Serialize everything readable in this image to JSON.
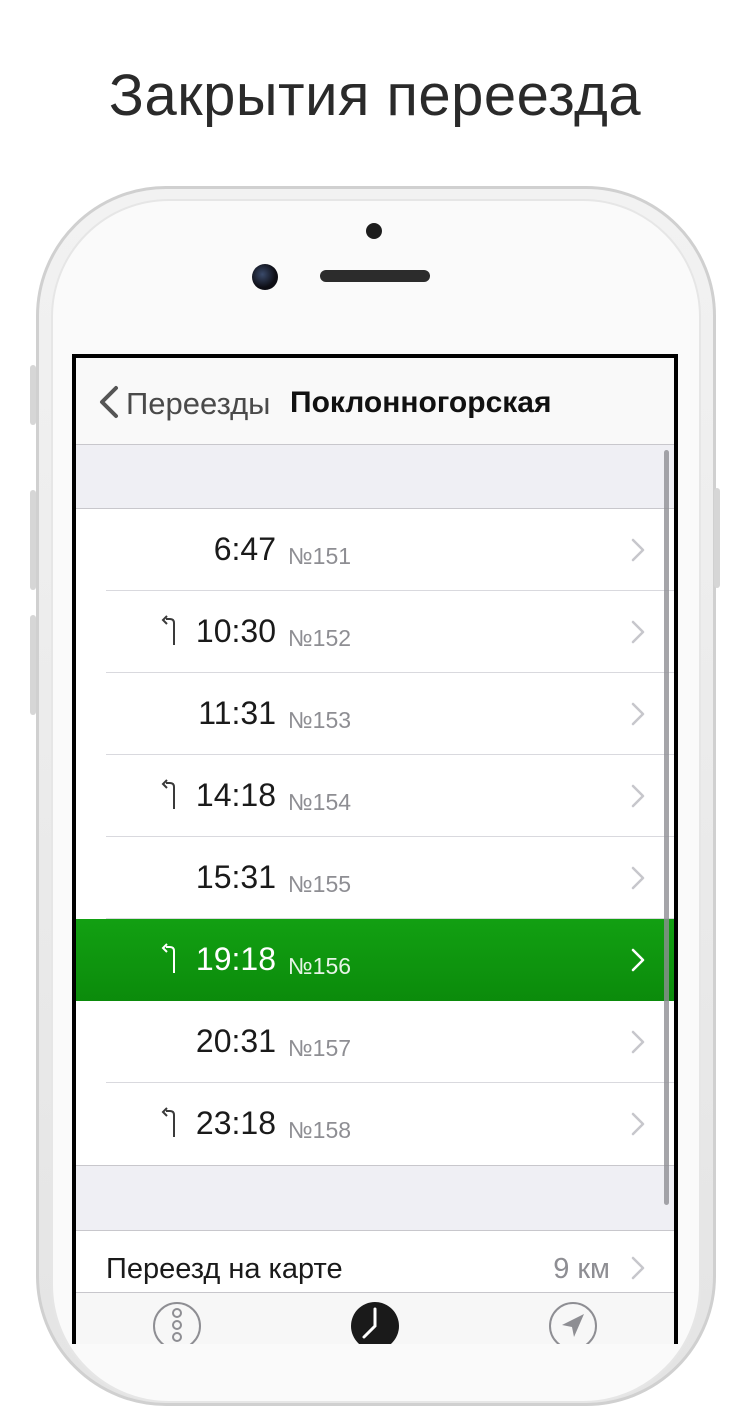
{
  "headline": "Закрытия переезда",
  "navbar": {
    "back_label": "Переезды",
    "title": "Поклонногорская"
  },
  "closures": [
    {
      "time": "6:47",
      "number": "№151",
      "turn_icon": false,
      "active": false
    },
    {
      "time": "10:30",
      "number": "№152",
      "turn_icon": true,
      "active": false
    },
    {
      "time": "11:31",
      "number": "№153",
      "turn_icon": false,
      "active": false
    },
    {
      "time": "14:18",
      "number": "№154",
      "turn_icon": true,
      "active": false
    },
    {
      "time": "15:31",
      "number": "№155",
      "turn_icon": false,
      "active": false
    },
    {
      "time": "19:18",
      "number": "№156",
      "turn_icon": true,
      "active": true
    },
    {
      "time": "20:31",
      "number": "№157",
      "turn_icon": false,
      "active": false
    },
    {
      "time": "23:18",
      "number": "№158",
      "turn_icon": true,
      "active": false
    }
  ],
  "map_row": {
    "label": "Переезд на карте",
    "distance": "9 км"
  },
  "tabbar": {
    "items": [
      "traffic-light-icon",
      "clock-icon",
      "location-arrow-icon"
    ]
  },
  "colors": {
    "active_row": "#0b8b0b",
    "secondary_text": "#8e8e93"
  }
}
